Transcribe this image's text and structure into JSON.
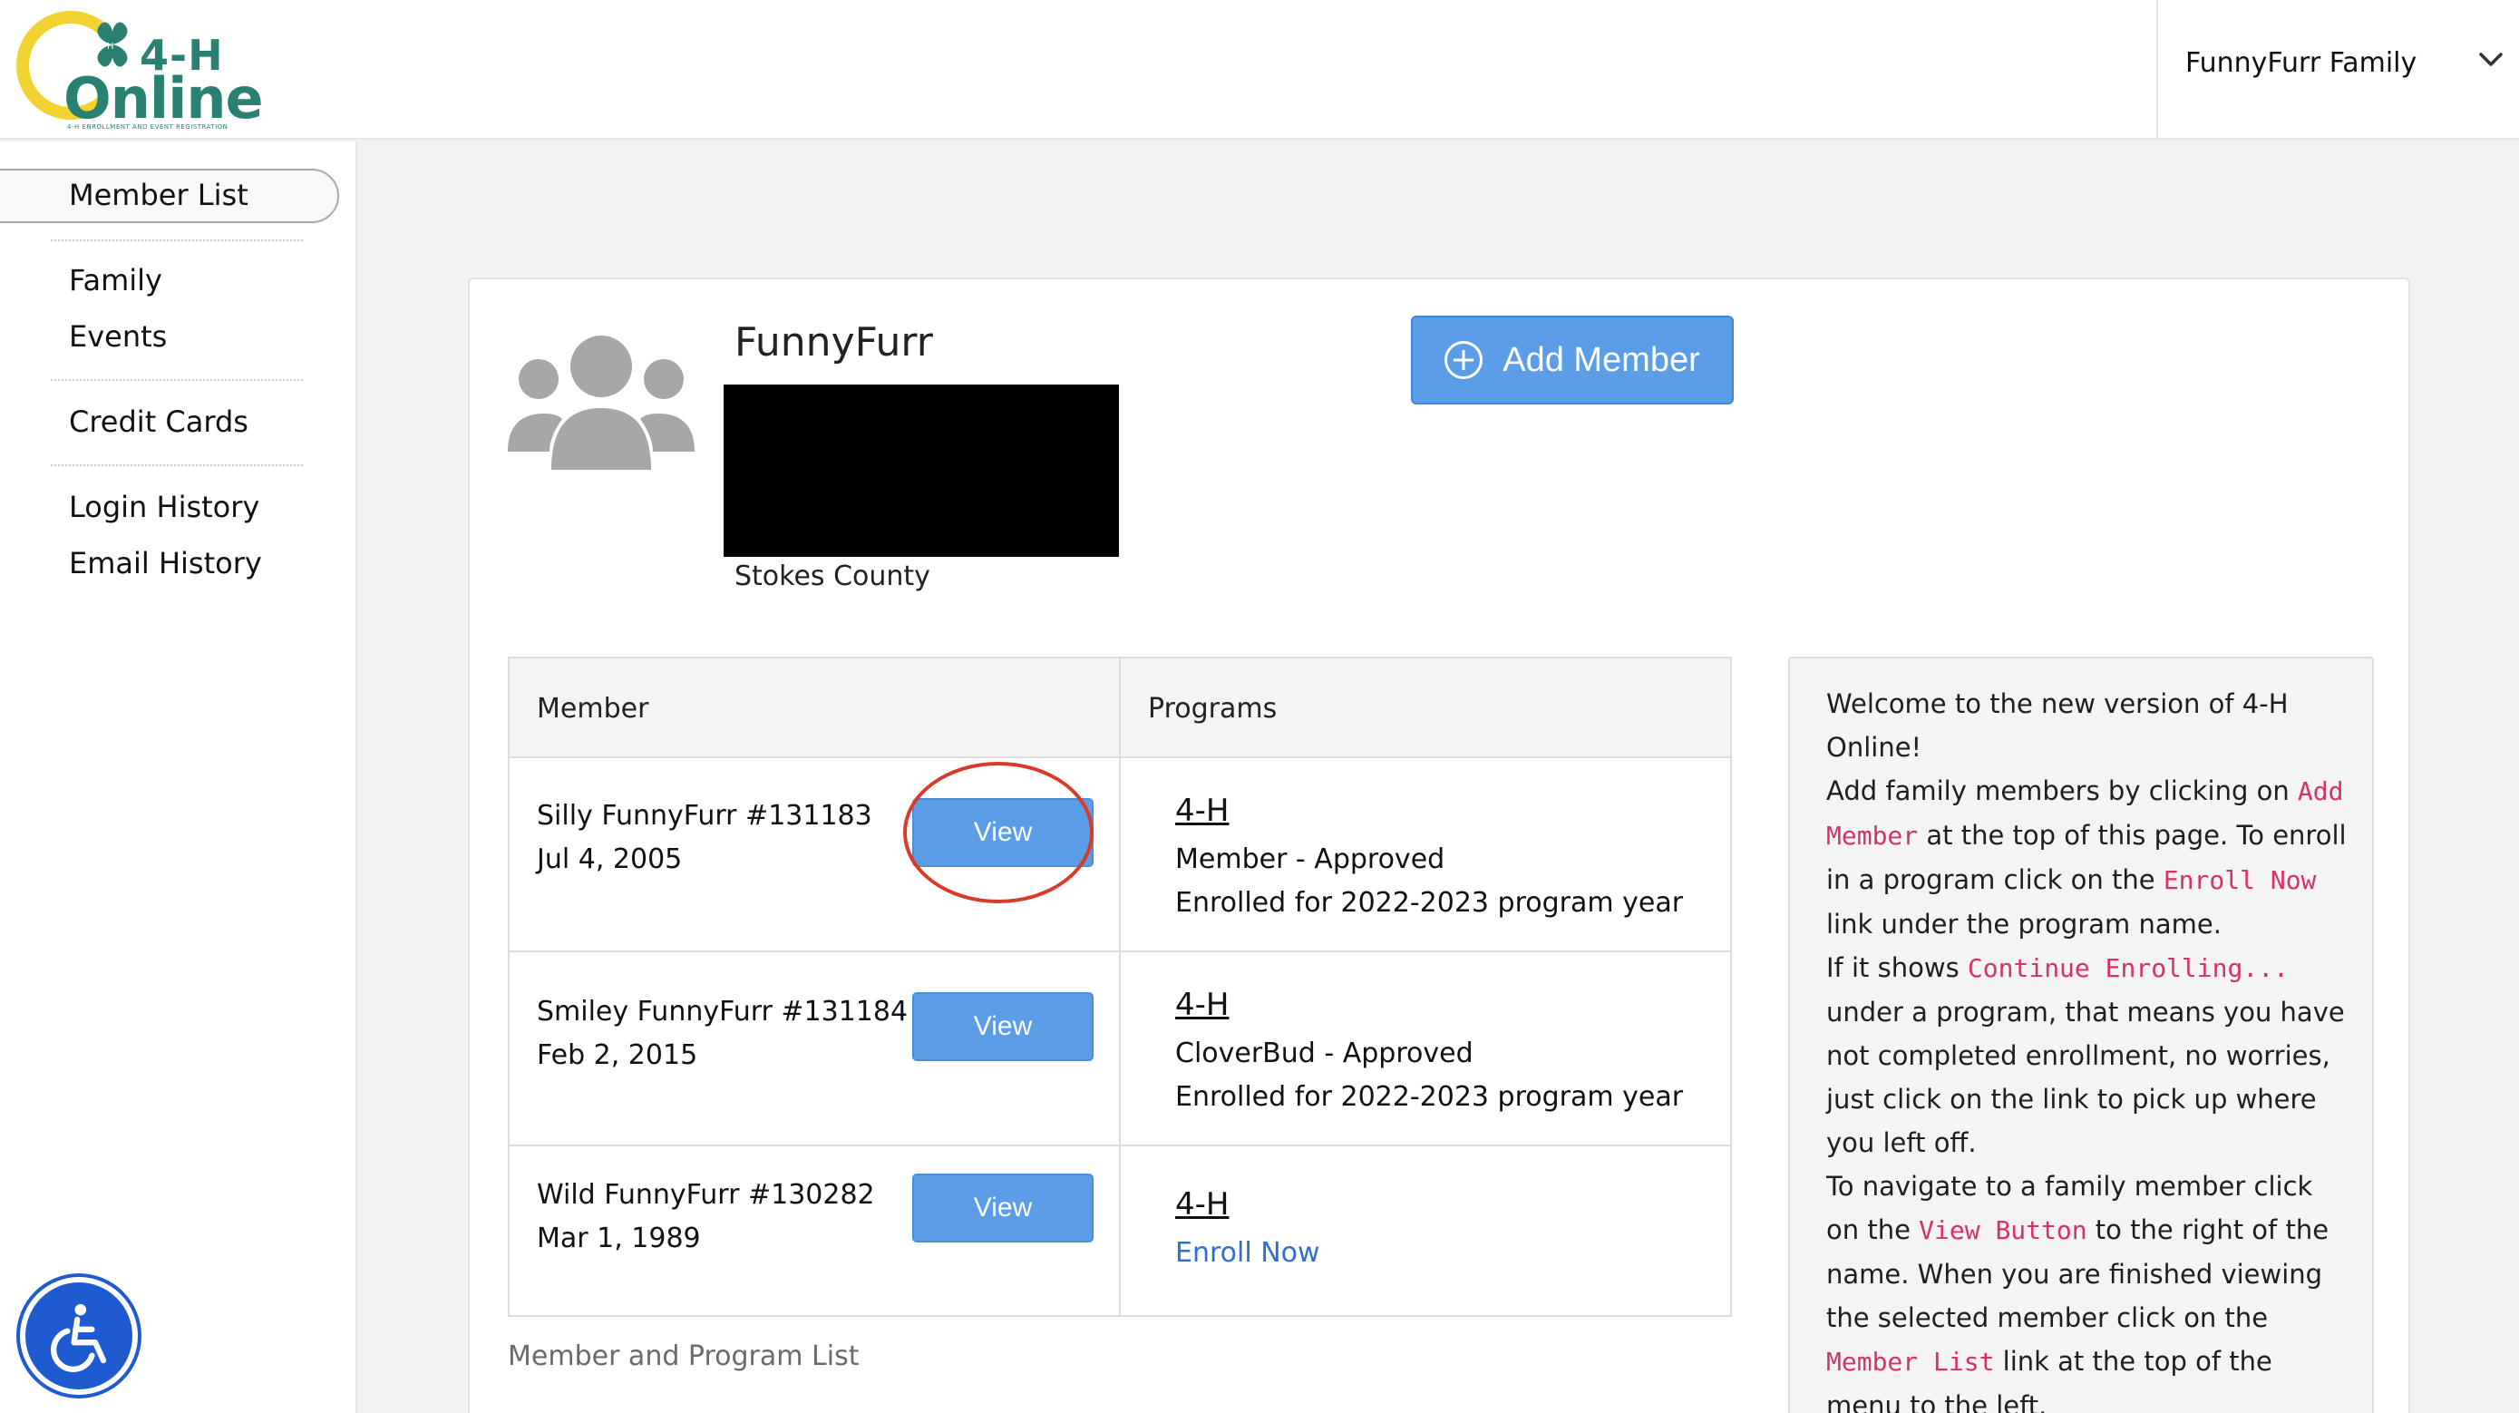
{
  "header": {
    "logo_primary": "4-H",
    "logo_secondary": "Online",
    "logo_tagline": "4-H ENROLLMENT AND EVENT REGISTRATION",
    "family_name": "FunnyFurr Family"
  },
  "sidebar": {
    "items": [
      {
        "label": "Member List",
        "active": true
      },
      {
        "label": "Family"
      },
      {
        "label": "Events"
      },
      {
        "label": "Credit Cards"
      },
      {
        "label": "Login History"
      },
      {
        "label": "Email History"
      }
    ]
  },
  "family": {
    "name": "FunnyFurr",
    "county": "Stokes County",
    "add_member_label": "Add Member"
  },
  "table": {
    "headers": {
      "member": "Member",
      "programs": "Programs"
    },
    "rows": [
      {
        "name": "Silly FunnyFurr #131183",
        "dob": "Jul 4, 2005",
        "view_label": "View",
        "program": "4-H",
        "status": "Member - Approved",
        "enrolled": "Enrolled for 2022-2023 program year"
      },
      {
        "name": "Smiley FunnyFurr #131184",
        "dob": "Feb 2, 2015",
        "view_label": "View",
        "program": "4-H",
        "status": "CloverBud - Approved",
        "enrolled": "Enrolled for 2022-2023 program year"
      },
      {
        "name": "Wild FunnyFurr #130282",
        "dob": "Mar 1, 1989",
        "view_label": "View",
        "program": "4-H",
        "action": "Enroll Now"
      }
    ],
    "caption": "Member and Program List"
  },
  "help": {
    "p1": "Welcome to the new version of 4-H Online!",
    "p2_a": "Add family members by clicking on ",
    "p2_code1": "Add Member",
    "p2_b": " at the top of this page. To enroll in a program click on the ",
    "p2_code2": "Enroll Now",
    "p2_c": " link under the program name.",
    "p3_a": "If it shows ",
    "p3_code": "Continue Enrolling...",
    "p3_b": " under a program, that means you have not completed enrollment, no worries, just click on the link to pick up where you left off.",
    "p4_a": "To navigate to a family member click on the ",
    "p4_code1": "View Button",
    "p4_b": " to the right of the name. When you are finished viewing the selected member click on the ",
    "p4_code2": "Member List",
    "p4_c": " link at the top of the menu to the left."
  },
  "colors": {
    "brand_teal": "#2a8073",
    "brand_yellow": "#f2d230",
    "button_blue": "#5b9de6",
    "link_blue": "#2d6fcf",
    "code_pink": "#d8306b",
    "annotation_red": "#d93a2a",
    "accessibility_blue": "#1f5bd0"
  }
}
